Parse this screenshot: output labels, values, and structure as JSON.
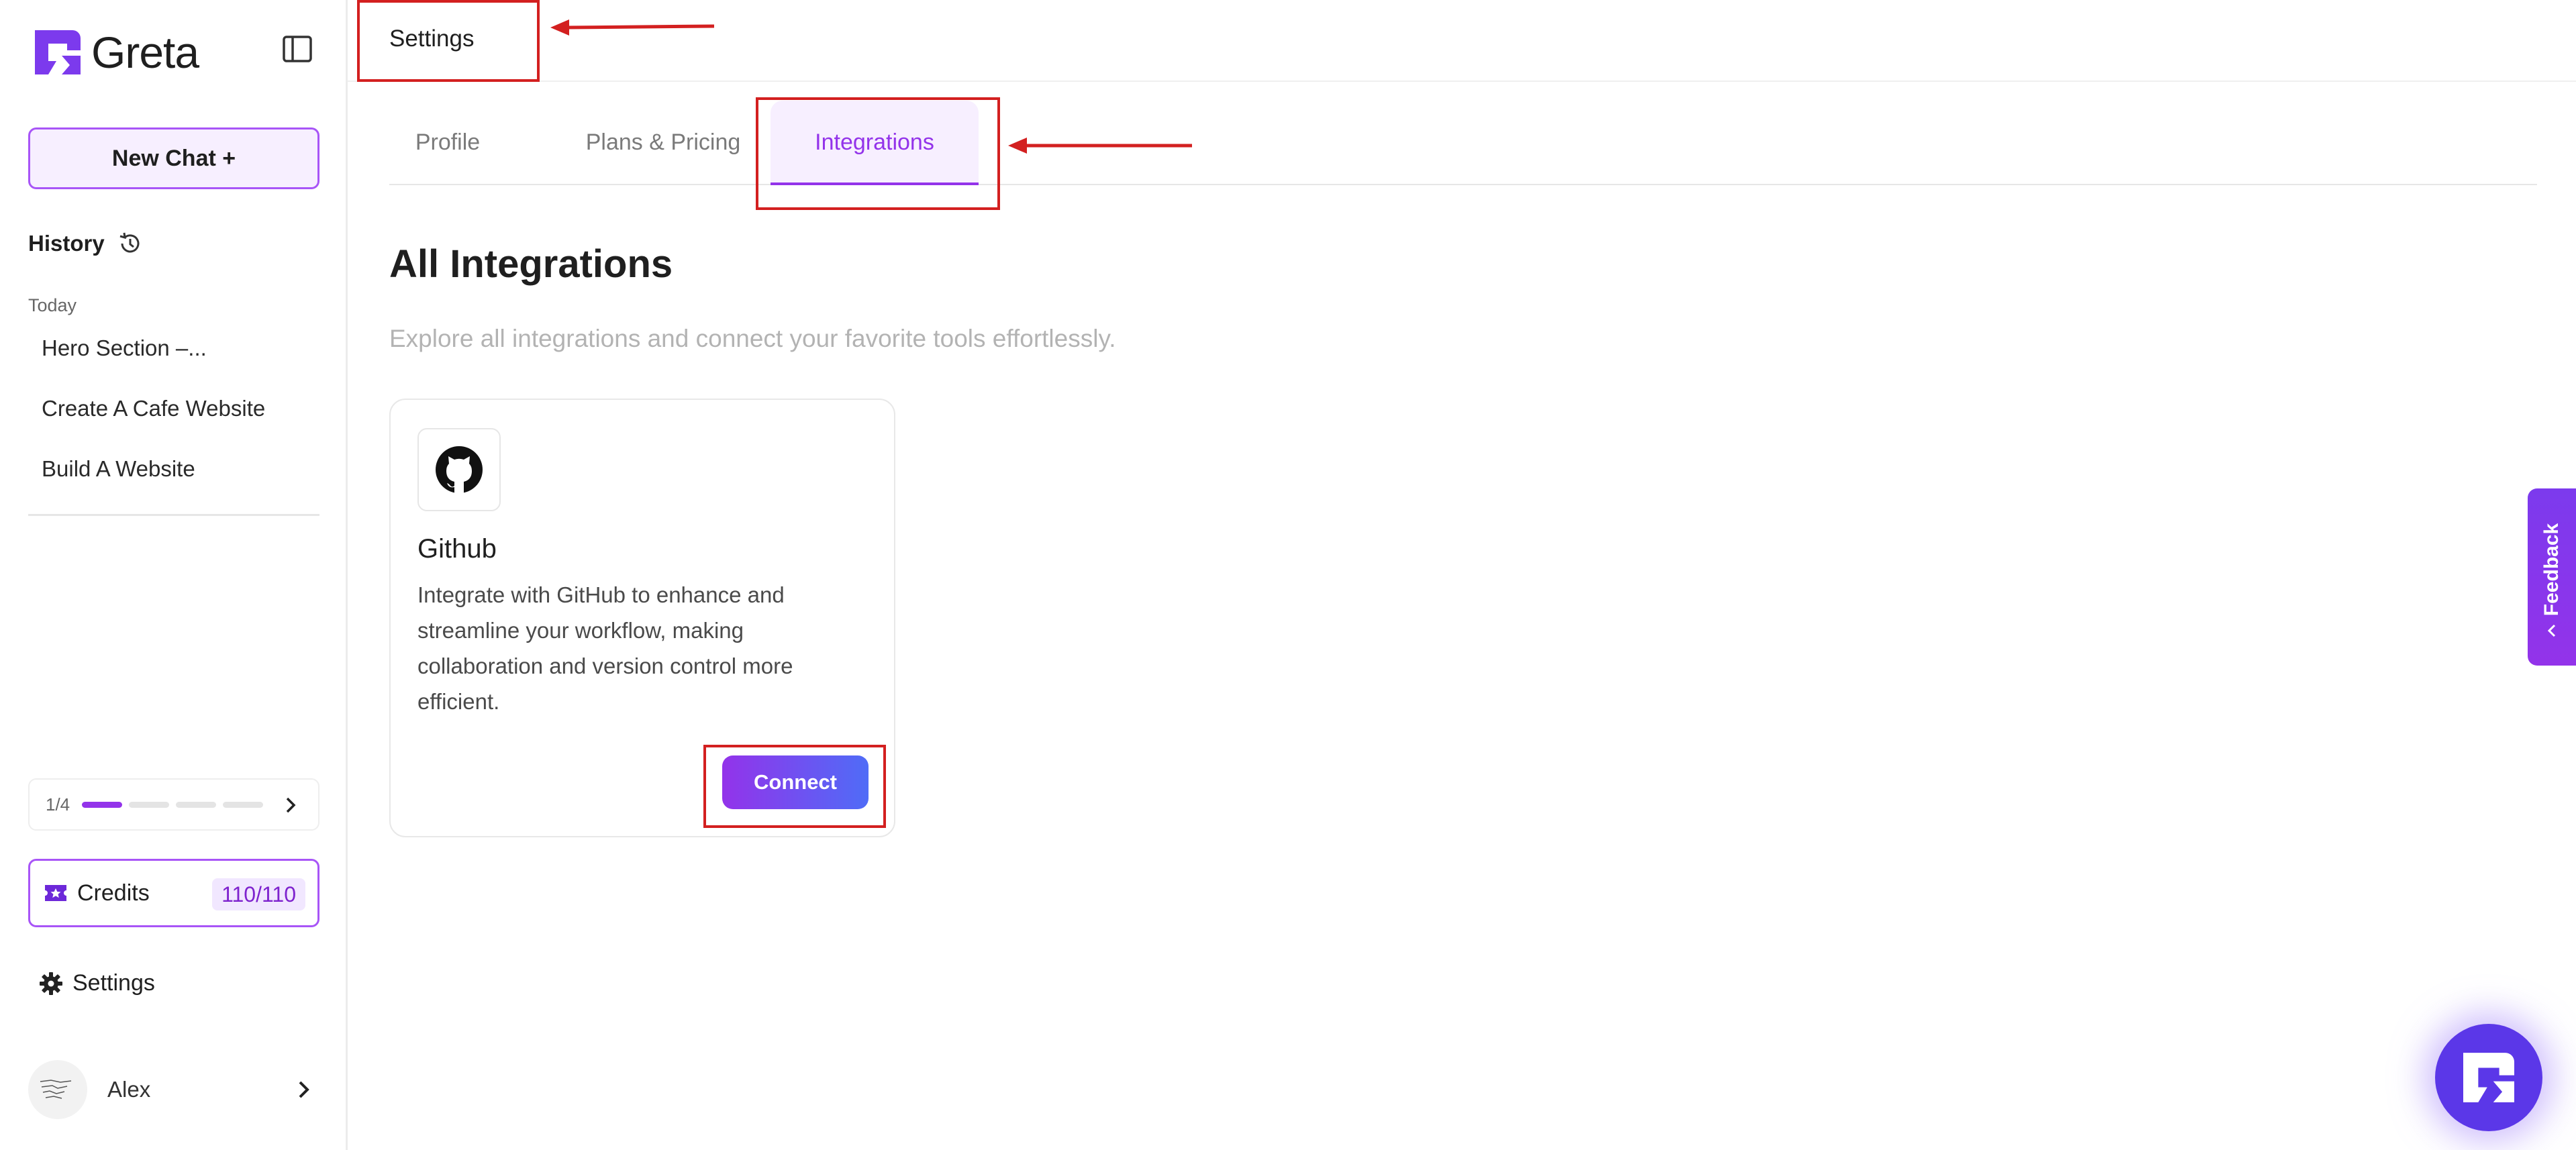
{
  "app": {
    "brand": "Greta"
  },
  "sidebar": {
    "new_chat_label": "New Chat +",
    "history_label": "History",
    "today_label": "Today",
    "history_items": [
      "Hero Section –...",
      "Create A Cafe Website",
      "Build A Website"
    ],
    "progress": {
      "label": "1/4",
      "completed": 1,
      "total": 4
    },
    "credits": {
      "label": "Credits",
      "value": "110/110"
    },
    "settings_label": "Settings",
    "user": {
      "name": "Alex"
    }
  },
  "header": {
    "title": "Settings"
  },
  "tabs": [
    {
      "label": "Profile",
      "active": false
    },
    {
      "label": "Plans & Pricing",
      "active": false
    },
    {
      "label": "Integrations",
      "active": true
    }
  ],
  "content": {
    "title": "All Integrations",
    "subtitle": "Explore all integrations and connect your favorite tools effortlessly.",
    "integrations": [
      {
        "name": "Github",
        "icon": "github-icon",
        "description": "Integrate with GitHub to enhance and streamline your workflow, making collaboration and version control more efficient.",
        "button_label": "Connect"
      }
    ]
  },
  "feedback_label": "Feedback",
  "colors": {
    "accent": "#9333ea",
    "annotation": "#d32020",
    "fab": "#5b37e8"
  }
}
